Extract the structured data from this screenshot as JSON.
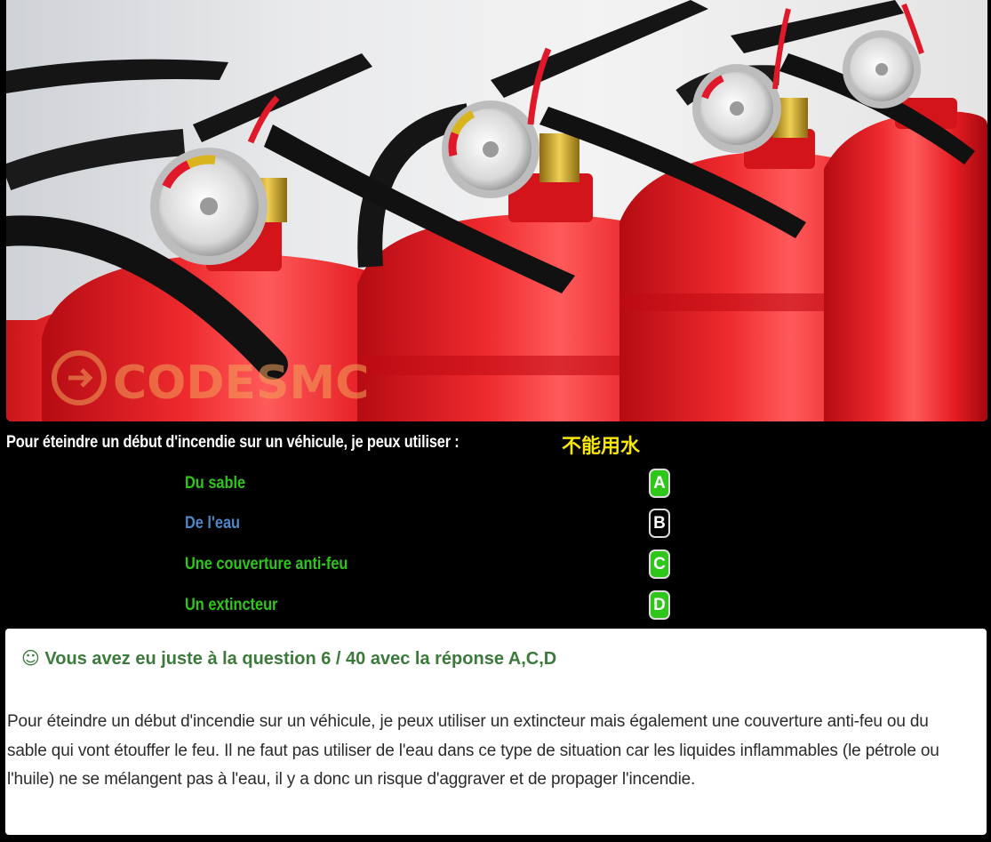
{
  "image": {
    "subject": "red-fire-extinguishers-photo",
    "watermark_text": "CODESMC"
  },
  "question": {
    "text": "Pour éteindre un début d'incendie sur un véhicule, je peux utiliser :",
    "hint": "不能用水"
  },
  "answers": [
    {
      "label": "Du sable",
      "letter": "A",
      "correct": true
    },
    {
      "label": "De l'eau",
      "letter": "B",
      "correct": false
    },
    {
      "label": "Une couverture anti-feu",
      "letter": "C",
      "correct": true
    },
    {
      "label": "Un extincteur",
      "letter": "D",
      "correct": true
    }
  ],
  "result": {
    "icon": "☺",
    "text": "Vous avez eu juste à la question 6 / 40 avec la réponse A,C,D"
  },
  "explanation": "Pour éteindre un début d'incendie sur un véhicule, je peux utiliser un extincteur mais également une couverture anti-feu ou du sable qui vont étouffer le feu. Il ne faut pas utiliser de l'eau dans ce type de situation car les liquides inflammables (le pétrole ou l'huile) ne se mélangent pas à l'eau, il y a donc un risque d'aggraver et de propager l'incendie.",
  "colors": {
    "correct": "#2fc61a",
    "wrong": "#4d86c9",
    "hint": "#f5e50a",
    "result": "#3c7a3c"
  }
}
